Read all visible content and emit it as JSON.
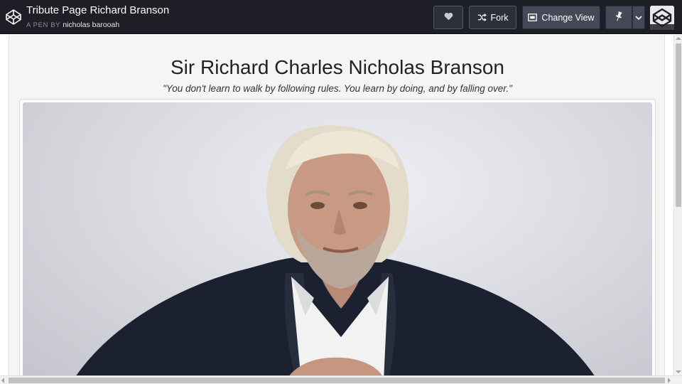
{
  "header": {
    "pen_title": "Tribute Page Richard Branson",
    "pen_by_prefix": "A PEN BY",
    "author": "nicholas barooah",
    "fork_label": "Fork",
    "change_view_label": "Change View",
    "icons": {
      "logo": "codepen-logo-icon",
      "heart": "heart-icon",
      "fork": "fork-icon",
      "view": "change-view-icon",
      "pin": "pin-icon",
      "caret": "chevron-down-icon",
      "avatar": "codepen-avatar"
    }
  },
  "page": {
    "title": "Sir Richard Charles Nicholas Branson",
    "quote": "\"You don't learn to walk by following rules. You learn by doing, and by falling over.\""
  },
  "colors": {
    "header_bg": "#1e1f26",
    "button_bg": "#444857",
    "well_bg": "#f5f5f5",
    "photo_bg": "#dcdde3"
  }
}
